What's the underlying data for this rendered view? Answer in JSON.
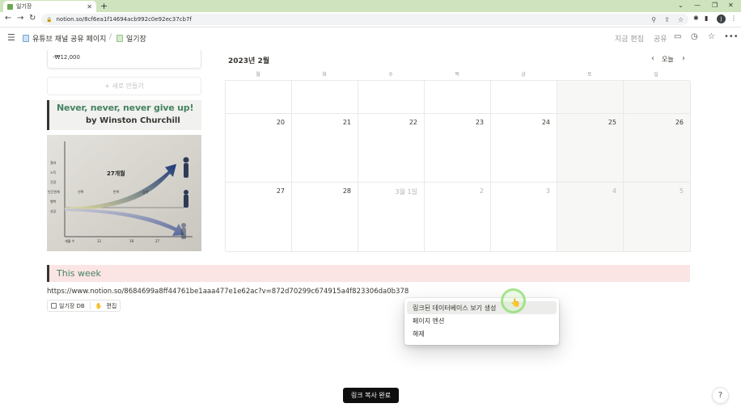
{
  "browser": {
    "tab_title": "일기장",
    "url": "notion.so/8cf6ea1f14694acb992c0e92ec37cb7f",
    "profile_initial": "J"
  },
  "topbar": {
    "breadcrumb_1": "유튜브 채널 공유 페이지",
    "breadcrumb_sep": "/",
    "breadcrumb_2": "일기장",
    "edit_label": "지금 편집",
    "share_label": "공유"
  },
  "card": {
    "amount": "-₩12,000"
  },
  "new_button": "+ 새로 만들기",
  "quote": {
    "line1": "Never, never, never give up!",
    "line2": "by Winston Churchill"
  },
  "photo": {
    "caption": "27개월",
    "row_labels": [
      "결과",
      "소득",
      "건강",
      "인간관계",
      "행복",
      "성공"
    ],
    "path_labels": [
      "선택",
      "반복",
      "습관"
    ],
    "x_labels": [
      "개월 수",
      "12",
      "18",
      "27"
    ]
  },
  "calendar": {
    "month_title": "2023년 2월",
    "today_label": "오늘",
    "weekdays": [
      "월",
      "화",
      "수",
      "목",
      "금",
      "토",
      "일"
    ],
    "rows": [
      [
        "",
        "",
        "",
        "",
        "",
        "",
        ""
      ],
      [
        "20",
        "21",
        "22",
        "23",
        "24",
        "25",
        "26"
      ],
      [
        "27",
        "28",
        "3월 1일",
        "2",
        "3",
        "4",
        "5"
      ]
    ]
  },
  "this_week": "This week",
  "link": {
    "url": "https://www.notion.so/8684699a8ff44761be1aaa477e1e62ac?v=872d70299c674915a4f823306da0b378",
    "mention_label": "일기장 DB",
    "edit_label": "편집"
  },
  "context_menu": {
    "items": [
      "링크된 데이터베이스 보기 생성",
      "페이지 멘션",
      "해제"
    ]
  },
  "toast": "링크 복사 완료",
  "help": "?"
}
